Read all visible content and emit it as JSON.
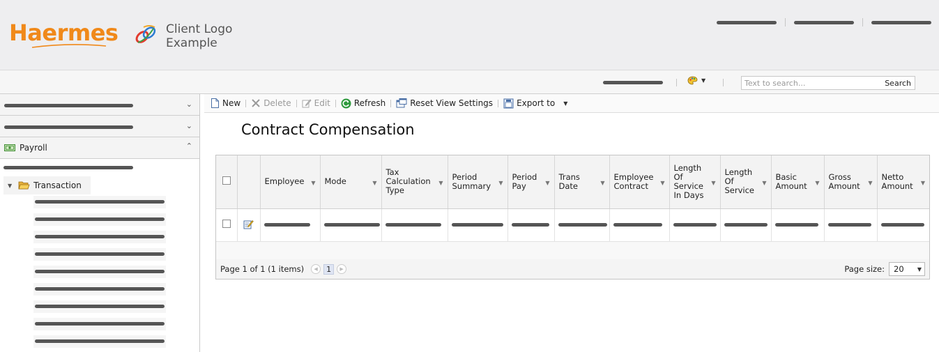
{
  "header": {
    "brand": "Haermes",
    "client_logo_line1": "Client Logo",
    "client_logo_line2": "Example"
  },
  "subbar": {
    "search_placeholder": "Text to search...",
    "search_button": "Search"
  },
  "sidebar": {
    "payroll_label": "Payroll",
    "transaction_label": "Transaction",
    "leaf_count": 9
  },
  "toolbar": {
    "new": "New",
    "delete": "Delete",
    "edit": "Edit",
    "refresh": "Refresh",
    "reset_view": "Reset View Settings",
    "export": "Export to"
  },
  "page_title": "Contract Compensation",
  "grid": {
    "columns": [
      "Employee",
      "Mode",
      "Tax Calculation Type",
      "Period Summary",
      "Period Pay",
      "Trans Date",
      "Employee Contract",
      "Length Of Service In Days",
      "Length Of Service",
      "Basic Amount",
      "Gross Amount",
      "Netto Amount"
    ],
    "pager_text": "Page 1 of 1 (1 items)",
    "current_page": "1",
    "page_size_label": "Page size:",
    "page_size_value": "20"
  },
  "colors": {
    "brand_orange": "#f0891a",
    "refresh_green": "#2f9a3e"
  }
}
